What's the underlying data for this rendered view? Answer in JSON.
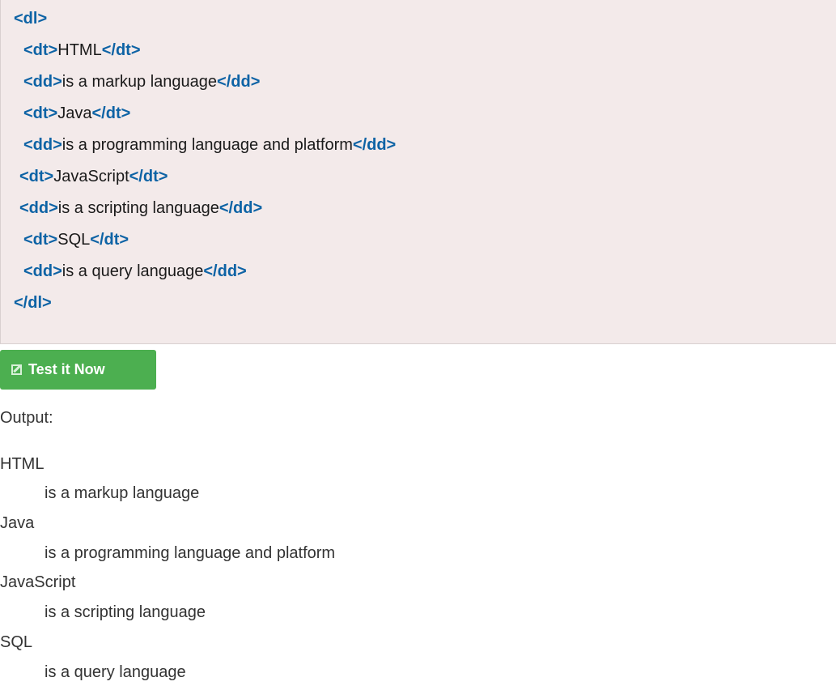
{
  "code": {
    "lines": [
      {
        "open": "<dl>",
        "text": "",
        "close": ""
      },
      {
        "open": "<dt>",
        "text": "HTML",
        "close": "</dt>"
      },
      {
        "open": "<dd>",
        "text": "is a markup language",
        "close": "</dd>"
      },
      {
        "open": "<dt>",
        "text": "Java",
        "close": "</dt>"
      },
      {
        "open": "<dd>",
        "text": "is a programming language and platform",
        "close": "</dd>"
      },
      {
        "open": "<dt>",
        "text": "JavaScript",
        "close": "</dt>"
      },
      {
        "open": "<dd>",
        "text": "is a scripting language",
        "close": "</dd>"
      },
      {
        "open": "<dt>",
        "text": "SQL",
        "close": "</dt>"
      },
      {
        "open": "<dd>",
        "text": "is a query language",
        "close": "</dd>"
      },
      {
        "open": "</dl>",
        "text": "",
        "close": ""
      }
    ]
  },
  "button": {
    "label": "Test it Now",
    "icon": "edit-icon",
    "color": "#4caf50"
  },
  "output": {
    "label": "Output:",
    "items": [
      {
        "term": "HTML",
        "definition": "is a markup language"
      },
      {
        "term": "Java",
        "definition": "is a programming language and platform"
      },
      {
        "term": "JavaScript",
        "definition": "is a scripting language"
      },
      {
        "term": "SQL",
        "definition": "is a query language"
      }
    ]
  },
  "colors": {
    "code_background": "#f3eaea",
    "tag": "#0d63a5"
  }
}
